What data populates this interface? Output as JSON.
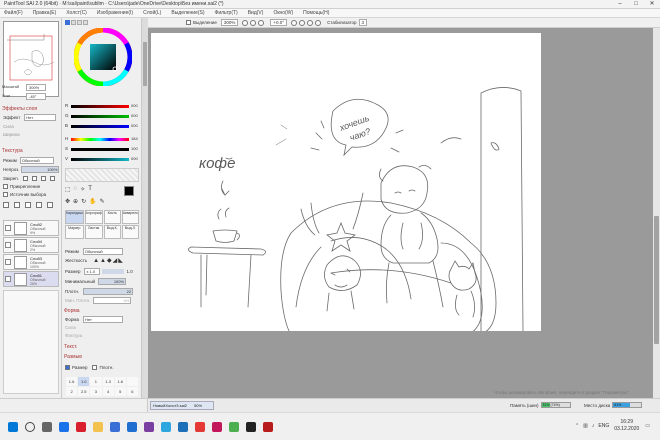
{
  "window": {
    "title": "PaintTool SAI 2.0 (64bit) · М:\\sai\\paint\\sublim · C:\\Users\\jade\\OneDrive\\Desktop\\Без имени.sai2 (*)"
  },
  "menubar": {
    "items": [
      "Файл(F)",
      "Правка(E)",
      "Холст(C)",
      "Изображение(I)",
      "Слой(L)",
      "Выделение(S)",
      "Фильтр(T)",
      "Вид(V)",
      "Окно(W)",
      "Помощь(H)"
    ]
  },
  "navigator": {
    "zoom_label": "Масштаб",
    "zoom_value": "300%",
    "angle_label": "Угол",
    "angle_value": "-45°"
  },
  "layer_effects": {
    "header": "Эффекты слоя",
    "effect_label": "Эффект",
    "effect_value": "Нет",
    "strength_label": "Сила",
    "width_label": "Ширина"
  },
  "texture": {
    "header": "Текстура",
    "mode_label": "Режим",
    "mode_value": "Обычный",
    "opacity_label": "Непроз.",
    "opacity_value": "100%",
    "protect_label": "Закреп.",
    "clip_label": "Прикрепление",
    "source_label": "Источник выбора"
  },
  "layers": [
    {
      "name": "Слой2",
      "mode": "Обычный",
      "opacity": "9%"
    },
    {
      "name": "Слой4",
      "mode": "Обычный",
      "opacity": "2%"
    },
    {
      "name": "Слой3",
      "mode": "Обычный",
      "opacity": "100%"
    },
    {
      "name": "Слой1",
      "mode": "Обычный",
      "opacity": "26%"
    }
  ],
  "color_sliders": {
    "rgb": [
      {
        "label": "R",
        "value": "000",
        "color": "#d33434"
      },
      {
        "label": "G",
        "value": "000",
        "color": "#2d9a3a"
      },
      {
        "label": "B",
        "value": "000",
        "color": "#2f46c9"
      }
    ],
    "hsv": [
      {
        "label": "H",
        "value": "184"
      },
      {
        "label": "S",
        "value": "100"
      },
      {
        "label": "V",
        "value": "000"
      }
    ]
  },
  "tools": [
    {
      "label": "Карандаш"
    },
    {
      "label": "Аэрограф"
    },
    {
      "label": "Кисть"
    },
    {
      "label": "Акварель"
    },
    {
      "label": "Маркер"
    },
    {
      "label": "Ластик"
    },
    {
      "label": "Выд.К."
    },
    {
      "label": "Выд.Л."
    }
  ],
  "brush": {
    "mode_label": "Режим",
    "mode_value": "Обычный",
    "hardness_label": "Жесткость",
    "size_label": "Размер",
    "size_multiplier": "x 1.0",
    "size_value": "1.0",
    "min_size_label": "Минимальный",
    "min_size_value": "100%",
    "density_label": "Плотн.",
    "density_value": "22",
    "min_density_label": "Мин. Плотн.",
    "min_density_value": "0%",
    "form_header": "Форма",
    "form_label": "Форма",
    "form_value": "Нет",
    "strength_label": "Сила",
    "texture_label": "Фактура",
    "text_header": "Текст.",
    "mix_header": "Размыв",
    "size_toggle_label": "Размер",
    "density_toggle_label": "Плотн."
  },
  "brush_sizes": [
    "1.6",
    "1.0",
    "1",
    "1.3",
    "1.6",
    "",
    "2",
    "2.5",
    "3",
    "4",
    "5",
    "6"
  ],
  "topbar": {
    "selection_label": "Выделение",
    "zoom_value": "300%",
    "angle_value": "+0.0°",
    "stabilizer_label": "Стабилизатор",
    "stabilizer_value": "3"
  },
  "status": {
    "doc_tab_name": "НовыйХолст3.sai2",
    "doc_tab_zoom": "50%",
    "activate_text": "Чтобы активировать Windows, перейдите в раздел \"Параметры\".",
    "memory_label": "Память (шин)",
    "memory_percent": "31% (74%)",
    "memory_fraction": 0.31,
    "disk_label": "Место диска",
    "disk_percent": "61%",
    "disk_fraction": 0.61,
    "memory_color": "#4cc36b",
    "disk_color": "#3aa0e0"
  },
  "canvas_text": {
    "coffee": "кофе",
    "want_line1": "хочешь",
    "want_line2": "чаю?"
  },
  "taskbar": {
    "lang": "ENG",
    "time": "16:29",
    "date": "03.12.2020",
    "icons": [
      {
        "name": "windows-start-icon",
        "color": "#0078d7"
      },
      {
        "name": "search-icon",
        "color": "#444444"
      },
      {
        "name": "task-view-icon",
        "color": "#666666"
      },
      {
        "name": "edge-icon",
        "color": "#1a73e8"
      },
      {
        "name": "opera-icon",
        "color": "#d91e2e"
      },
      {
        "name": "explorer-folder-icon",
        "color": "#f2c14e"
      },
      {
        "name": "store-icon",
        "color": "#3a6fd8"
      },
      {
        "name": "mail-icon",
        "color": "#1f6fd1"
      },
      {
        "name": "sai-icon",
        "color": "#7a3fa0"
      },
      {
        "name": "telegram-icon",
        "color": "#2ea6df"
      },
      {
        "name": "photos-icon",
        "color": "#1d6fb8"
      },
      {
        "name": "yandex-icon",
        "color": "#e53935"
      },
      {
        "name": "music-icon",
        "color": "#c2185b"
      },
      {
        "name": "chrome-icon",
        "color": "#4caf50"
      },
      {
        "name": "app-icon",
        "color": "#222222"
      },
      {
        "name": "red-app-icon",
        "color": "#b71c1c"
      }
    ]
  }
}
